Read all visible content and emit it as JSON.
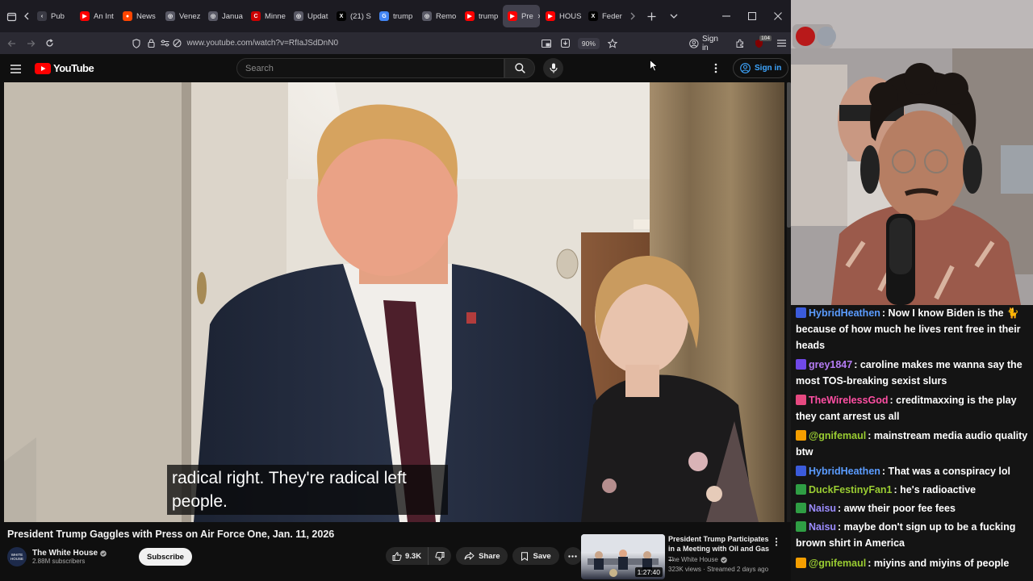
{
  "browser": {
    "tabs": [
      {
        "label": "Pub",
        "favicon": "bookmark"
      },
      {
        "label": "An Int",
        "favicon": "youtube"
      },
      {
        "label": "News",
        "favicon": "reddit"
      },
      {
        "label": "Venez",
        "favicon": "web"
      },
      {
        "label": "Janua",
        "favicon": "web"
      },
      {
        "label": "Minne",
        "favicon": "cnn"
      },
      {
        "label": "Updat",
        "favicon": "web"
      },
      {
        "label": "(21) S",
        "favicon": "x"
      },
      {
        "label": "trump",
        "favicon": "google"
      },
      {
        "label": "Remo",
        "favicon": "web"
      },
      {
        "label": "trump",
        "favicon": "youtube"
      },
      {
        "label": "Pre",
        "favicon": "youtube"
      },
      {
        "label": "HOUS",
        "favicon": "youtube"
      },
      {
        "label": "Feder",
        "favicon": "x"
      }
    ],
    "active_tab_index": 11,
    "url": "www.youtube.com/watch?v=RfIaJSdDnN0",
    "zoom": "90%",
    "sign_in": "Sign in",
    "extension_badge": "104"
  },
  "youtube": {
    "logo_text": "YouTube",
    "search_placeholder": "Search",
    "sign_in": "Sign in",
    "caption_line1": "radical right. They're radical left",
    "caption_line2": "people.",
    "video_title": "President Trump Gaggles with Press on Air Force One, Jan. 11, 2026",
    "channel_name": "The White House",
    "channel_avatar_text": "WHITE HOUSE",
    "subscribers": "2.88M subscribers",
    "subscribe_label": "Subscribe",
    "like_count": "9.3K",
    "share_label": "Share",
    "save_label": "Save",
    "recommended": {
      "title": "President Trump Participates in a Meeting with Oil and Gas ...",
      "channel": "The White House",
      "meta": "323K views · Streamed 2 days ago",
      "duration": "1:27:40"
    }
  },
  "chat": [
    {
      "user": "HybridHeathen",
      "color": "#5b9cff",
      "text": ": Now I know Biden is the 🐈 because of how much he lives rent free in their heads"
    },
    {
      "user": "grey1847",
      "color": "#b57cf5",
      "text": ": caroline makes me wanna say the most TOS-breaking sexist slurs"
    },
    {
      "user": "TheWirelessGod",
      "color": "#ff4fa3",
      "text": ": creditmaxxing is the play they cant arrest us all"
    },
    {
      "user": "@gnifemaul",
      "color": "#9acd32",
      "text": ": mainstream media audio quality btw"
    },
    {
      "user": "HybridHeathen",
      "color": "#5b9cff",
      "text": ": That was a conspiracy lol"
    },
    {
      "user": "DuckFestinyFan1",
      "color": "#9acd32",
      "text": ": he's radioactive"
    },
    {
      "user": "Naisu",
      "color": "#9b8cff",
      "text": ": aww their poor fee fees"
    },
    {
      "user": "Naisu",
      "color": "#9b8cff",
      "text": ": maybe don't sign up to be a fucking brown shirt in America"
    },
    {
      "user": "@gnifemaul",
      "color": "#9acd32",
      "text": ": miyins and miyins of people"
    }
  ],
  "colors": {
    "youtube_red": "#ff0000",
    "link_blue": "#3ea6ff"
  }
}
